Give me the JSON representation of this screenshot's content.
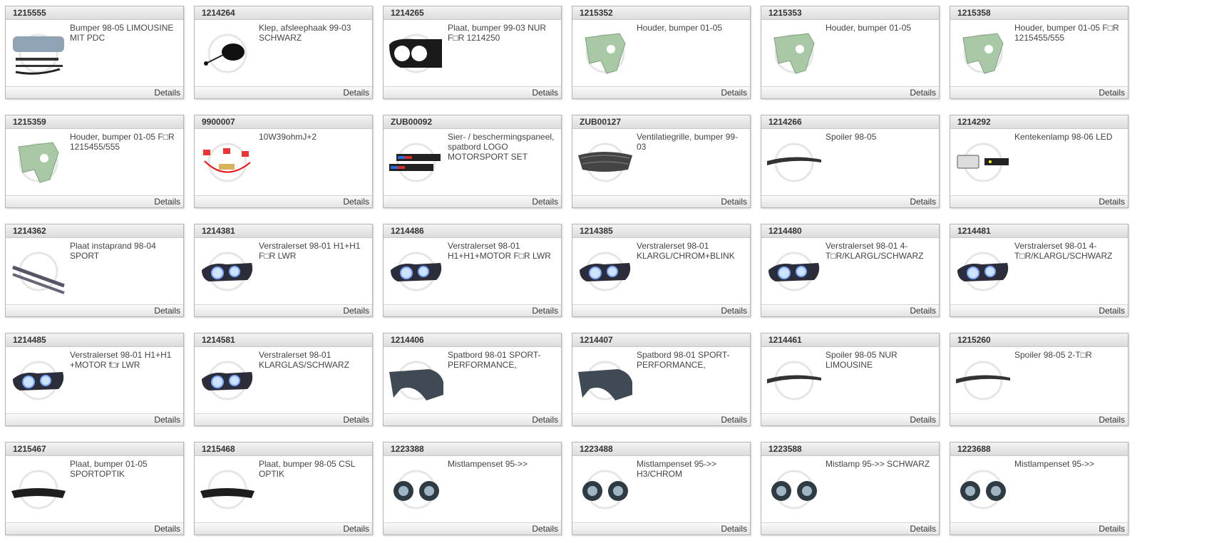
{
  "details_label": "Details",
  "items": [
    {
      "code": "1215555",
      "desc": "Bumper 98-05 LIMOUSINE MIT PDC",
      "icon": "bumper-icon"
    },
    {
      "code": "1214264",
      "desc": "Klep, afsleephaak 99-03 SCHWARZ",
      "icon": "tow-hook-cover-icon"
    },
    {
      "code": "1214265",
      "desc": "Plaat, bumper 99-03 NUR F□R 1214250",
      "icon": "bumper-plate-icon"
    },
    {
      "code": "1215352",
      "desc": "Houder, bumper 01-05",
      "icon": "bracket-icon"
    },
    {
      "code": "1215353",
      "desc": "Houder, bumper 01-05",
      "icon": "bracket-icon"
    },
    {
      "code": "1215358",
      "desc": "Houder, bumper 01-05 F□R 1215455/555",
      "icon": "bracket-icon"
    },
    {
      "code": "1215359",
      "desc": "Houder, bumper 01-05 F□R 1215455/555",
      "icon": "bracket-icon"
    },
    {
      "code": "9900007",
      "desc": "10W39ohmJ+2",
      "icon": "resistor-icon"
    },
    {
      "code": "ZUB00092",
      "desc": "Sier- / beschermingspaneel, spatbord LOGO MOTORSPORT SET",
      "icon": "badge-icon"
    },
    {
      "code": "ZUB00127",
      "desc": "Ventilatiegrille, bumper 99-03",
      "icon": "grille-icon"
    },
    {
      "code": "1214266",
      "desc": "Spoiler 98-05",
      "icon": "spoiler-icon"
    },
    {
      "code": "1214292",
      "desc": "Kentekenlamp 98-06 LED",
      "icon": "license-lamp-icon"
    },
    {
      "code": "1214362",
      "desc": "Plaat instaprand 98-04 SPORT",
      "icon": "sill-plate-icon"
    },
    {
      "code": "1214381",
      "desc": "Verstralerset 98-01 H1+H1 F□R LWR",
      "icon": "headlight-icon"
    },
    {
      "code": "1214486",
      "desc": "Verstralerset 98-01 H1+H1+MOTOR F□R LWR",
      "icon": "headlight-icon"
    },
    {
      "code": "1214385",
      "desc": "Verstralerset 98-01 KLARGL/CHROM+BLINK",
      "icon": "headlight-icon"
    },
    {
      "code": "1214480",
      "desc": "Verstralerset 98-01 4-T□R/KLARGL/SCHWARZ",
      "icon": "headlight-icon"
    },
    {
      "code": "1214481",
      "desc": "Verstralerset 98-01 4-T□R/KLARGL/SCHWARZ",
      "icon": "headlight-icon"
    },
    {
      "code": "1214485",
      "desc": "Verstralerset 98-01 H1+H1 +MOTOR f□r LWR",
      "icon": "headlight-icon"
    },
    {
      "code": "1214581",
      "desc": "Verstralerset 98-01 KLARGLAS/SCHWARZ",
      "icon": "headlight-icon"
    },
    {
      "code": "1214406",
      "desc": "Spatbord 98-01 SPORT-PERFORMANCE,",
      "icon": "fender-icon"
    },
    {
      "code": "1214407",
      "desc": "Spatbord 98-01 SPORT-PERFORMANCE,",
      "icon": "fender-icon"
    },
    {
      "code": "1214461",
      "desc": "Spoiler 98-05 NUR LIMOUSINE",
      "icon": "spoiler-icon"
    },
    {
      "code": "1215260",
      "desc": "Spoiler 98-05 2-T□R",
      "icon": "spoiler-icon"
    },
    {
      "code": "1215467",
      "desc": "Plaat, bumper 01-05 SPORTOPTIK",
      "icon": "diffuser-icon"
    },
    {
      "code": "1215468",
      "desc": "Plaat, bumper 98-05 CSL OPTIK",
      "icon": "diffuser-icon"
    },
    {
      "code": "1223388",
      "desc": "Mistlampenset 95->>",
      "icon": "fog-lamp-icon"
    },
    {
      "code": "1223488",
      "desc": "Mistlampenset 95->> H3/CHROM",
      "icon": "fog-lamp-icon"
    },
    {
      "code": "1223588",
      "desc": "Mistlamp 95->> SCHWARZ",
      "icon": "fog-lamp-icon"
    },
    {
      "code": "1223688",
      "desc": "Mistlampenset 95->>",
      "icon": "fog-lamp-icon"
    }
  ]
}
